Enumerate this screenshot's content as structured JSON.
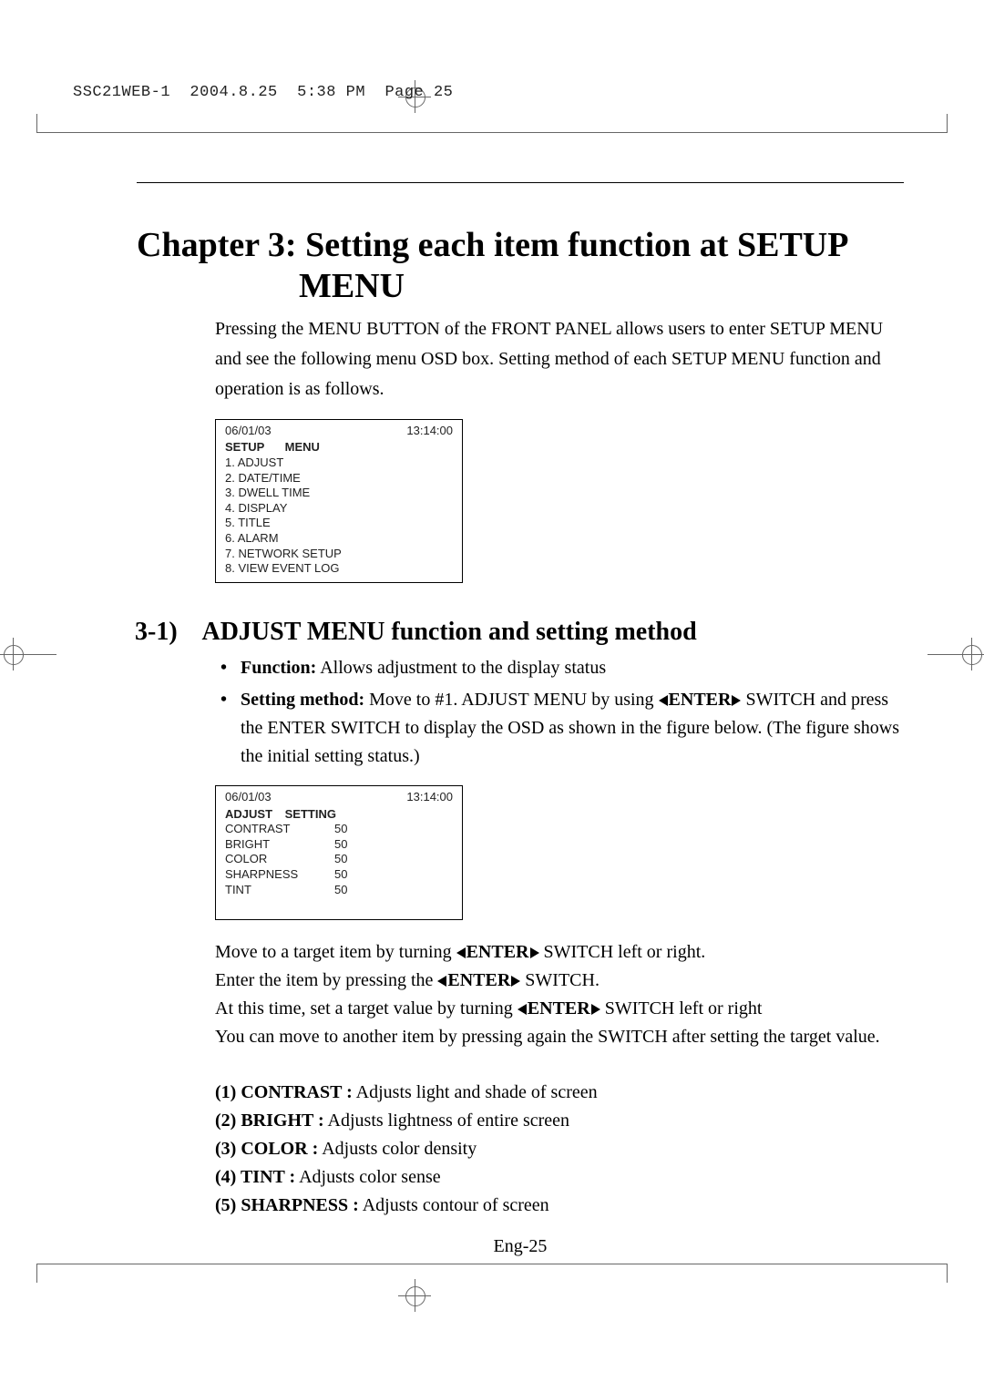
{
  "slugline": "SSC21WEB-1  2004.8.25  5:38 PM  Page 25",
  "chapter_label": "Chapter 3:",
  "chapter_title": "Setting each item function at SETUP MENU",
  "intro": "Pressing the MENU BUTTON of the FRONT PANEL allows users to enter SETUP MENU and see the following menu OSD box. Setting method of each SETUP MENU function and operation is as follows.",
  "osd1": {
    "date": "06/01/03",
    "time": "13:14:00",
    "header_col1": "SETUP",
    "header_col2": "MENU",
    "items": [
      "1. ADJUST",
      "2. DATE/TIME",
      "3. DWELL TIME",
      "4. DISPLAY",
      "5. TITLE",
      "6. ALARM",
      "7. NETWORK SETUP",
      "8. VIEW EVENT LOG"
    ]
  },
  "section_num": "3-1)",
  "section_title": "ADJUST MENU function and setting method",
  "bullet_function_label": "Function:",
  "bullet_function_text": " Allows adjustment to the display status",
  "bullet_method_label": "Setting method:",
  "bullet_method_pre": " Move to #1. ADJUST MENU by using ",
  "enter_word": "ENTER",
  "bullet_method_post": " SWITCH and press the ENTER SWITCH to display the OSD as shown in the figure below. (The figure shows the initial setting status.)",
  "osd2": {
    "date": "06/01/03",
    "time": "13:14:00",
    "header_col1": "ADJUST",
    "header_col2": "SETTING",
    "rows": [
      {
        "name": "CONTRAST",
        "value": "50"
      },
      {
        "name": "BRIGHT",
        "value": "50"
      },
      {
        "name": "COLOR",
        "value": "50"
      },
      {
        "name": "SHARPNESS",
        "value": "50"
      },
      {
        "name": "TINT",
        "value": "50"
      }
    ]
  },
  "body_lines_pre1": "Move to a target item by turning ",
  "body_lines_post1": " SWITCH left or right.",
  "body_lines_pre2": "Enter the item by pressing the ",
  "body_lines_post2": " SWITCH.",
  "body_lines_pre3": "At this time, set a target value by turning ",
  "body_lines_post3": " SWITCH left or right",
  "body_line4": "You can move to another item by pressing again the SWITCH after setting the target value.",
  "defs": [
    {
      "label": "(1) CONTRAST :",
      "text": " Adjusts light and shade of screen"
    },
    {
      "label": "(2) BRIGHT :",
      "text": " Adjusts lightness of entire screen"
    },
    {
      "label": "(3) COLOR :",
      "text": " Adjusts color density"
    },
    {
      "label": "(4) TINT :",
      "text": " Adjusts color sense"
    },
    {
      "label": "(5) SHARPNESS :",
      "text": " Adjusts contour of screen"
    }
  ],
  "page_number": "Eng-25"
}
